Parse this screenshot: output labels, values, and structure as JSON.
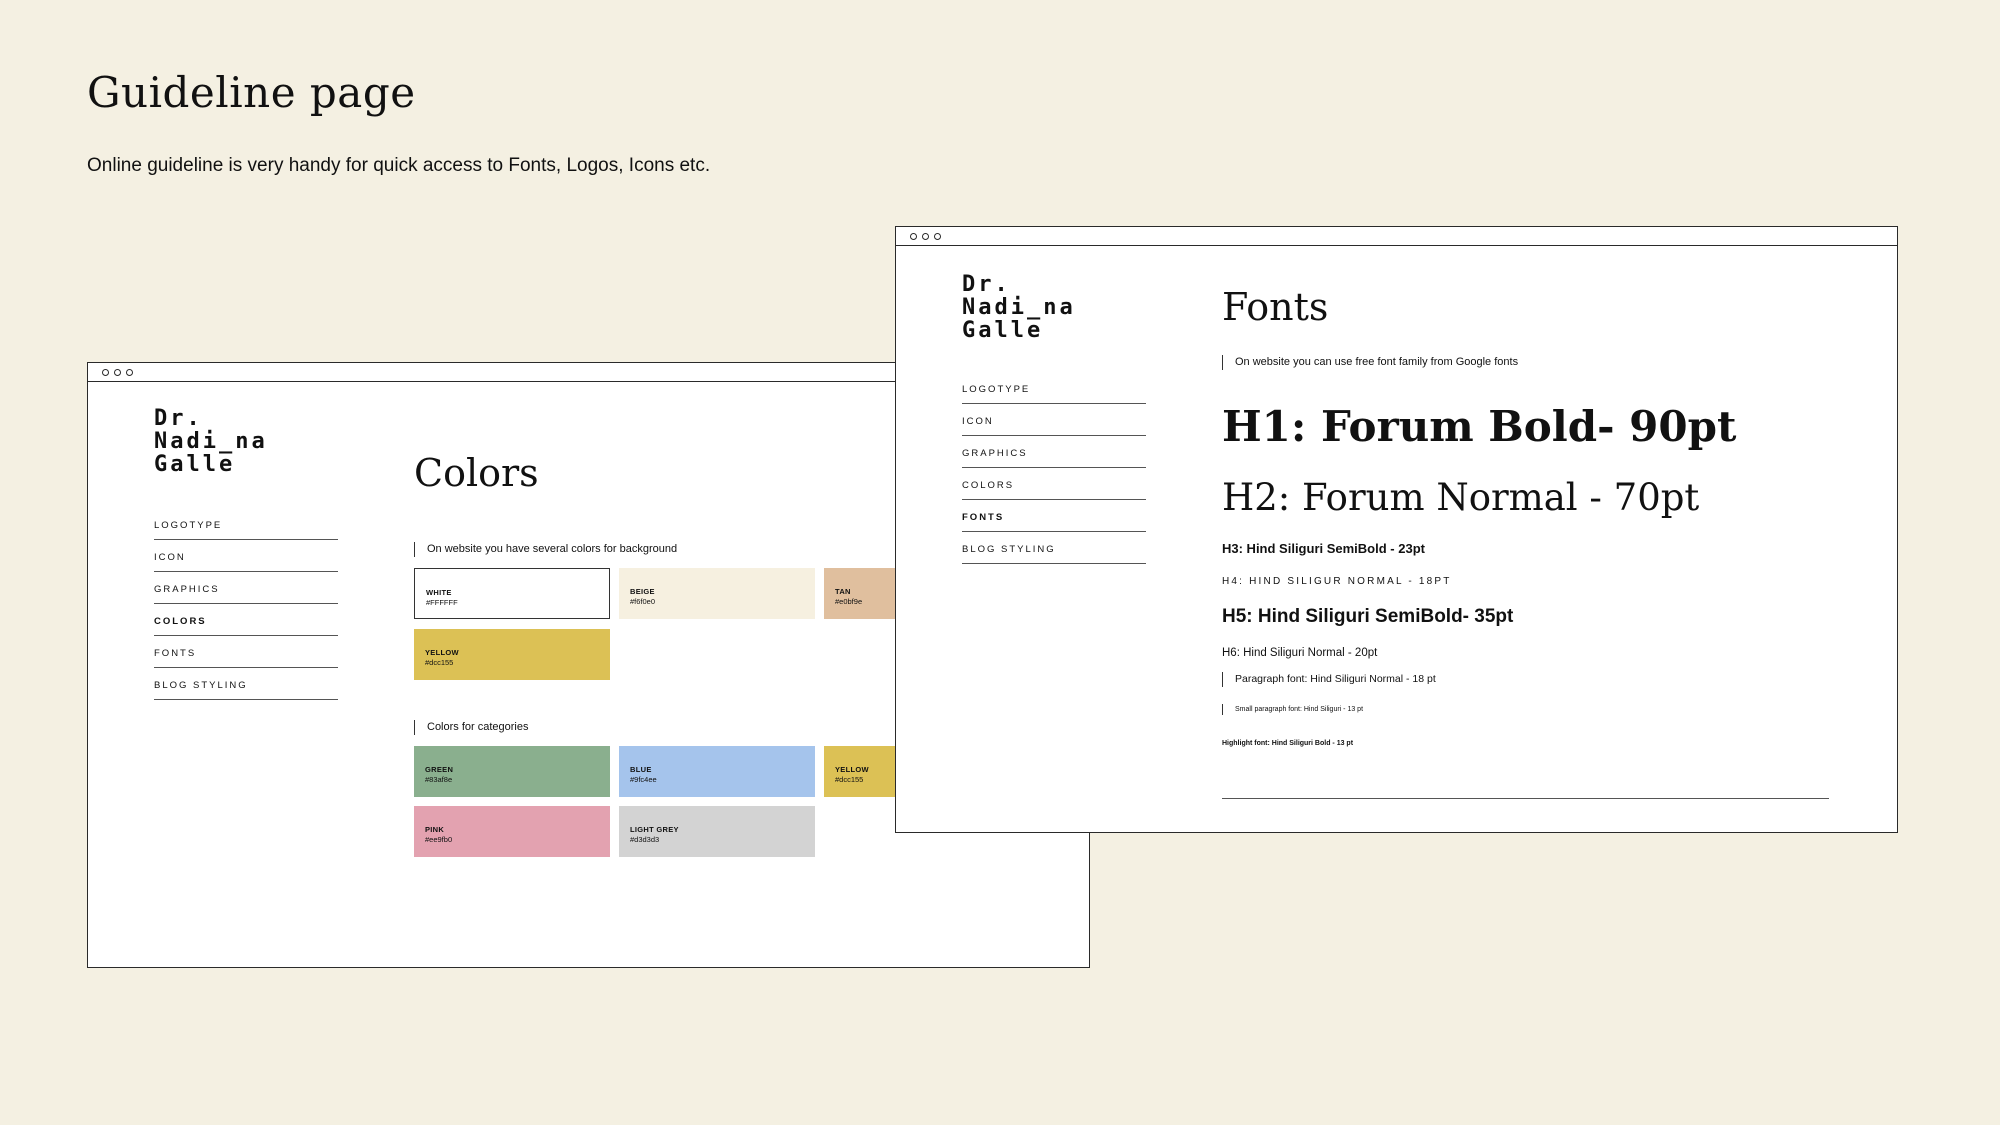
{
  "page": {
    "title": "Guideline page",
    "subtitle": "Online guideline is very handy for quick access to Fonts, Logos, Icons etc."
  },
  "logo": {
    "lines": [
      "Dr.",
      "Nadi_na",
      "Galle"
    ]
  },
  "nav": {
    "items": [
      "LOGOTYPE",
      "ICON",
      "GRAPHICS",
      "COLORS",
      "FONTS",
      "BLOG STYLING"
    ]
  },
  "colors_window": {
    "active_nav": "COLORS",
    "section_title": "Colors",
    "background_note": "On website you have several colors for background",
    "background_swatches": [
      {
        "name": "WHITE",
        "hex": "#FFFFFF",
        "color": "#ffffff"
      },
      {
        "name": "BEIGE",
        "hex": "#f6f0e0",
        "color": "#f6f0e0"
      },
      {
        "name": "TAN",
        "hex": "#e0bf9e",
        "color": "#e0bf9e"
      },
      {
        "name": "YELLOW",
        "hex": "#dcc155",
        "color": "#dcc155"
      }
    ],
    "categories_note": "Colors for categories",
    "category_swatches": [
      {
        "name": "GREEN",
        "hex": "#83af8e",
        "color": "#8aaf8e"
      },
      {
        "name": "BLUE",
        "hex": "#9fc4ee",
        "color": "#a5c4ec"
      },
      {
        "name": "YELLOW",
        "hex": "#dcc155",
        "color": "#dcc155"
      },
      {
        "name": "PINK",
        "hex": "#ee9fb0",
        "color": "#e3a2b0"
      },
      {
        "name": "LIGHT GREY",
        "hex": "#d3d3d3",
        "color": "#d3d3d3"
      }
    ]
  },
  "fonts_window": {
    "active_nav": "FONTS",
    "section_title": "Fonts",
    "note": "On website you can use free font family from Google fonts",
    "h1": "H1: Forum Bold- 90pt",
    "h2": "H2: Forum Normal - 70pt",
    "h3": "H3: Hind Siliguri SemiBold - 23pt",
    "h4": "H4: HIND SILIGUR NORMAL - 18PT",
    "h5": "H5: Hind Siliguri SemiBold- 35pt",
    "h6": "H6: Hind Siliguri Normal - 20pt",
    "paragraph": "Paragraph font: Hind Siliguri Normal - 18 pt",
    "small_paragraph": "Small paragraph font: Hind Siliguri - 13 pt",
    "highlight": "Highlight font: Hind Siliguri Bold - 13 pt"
  }
}
